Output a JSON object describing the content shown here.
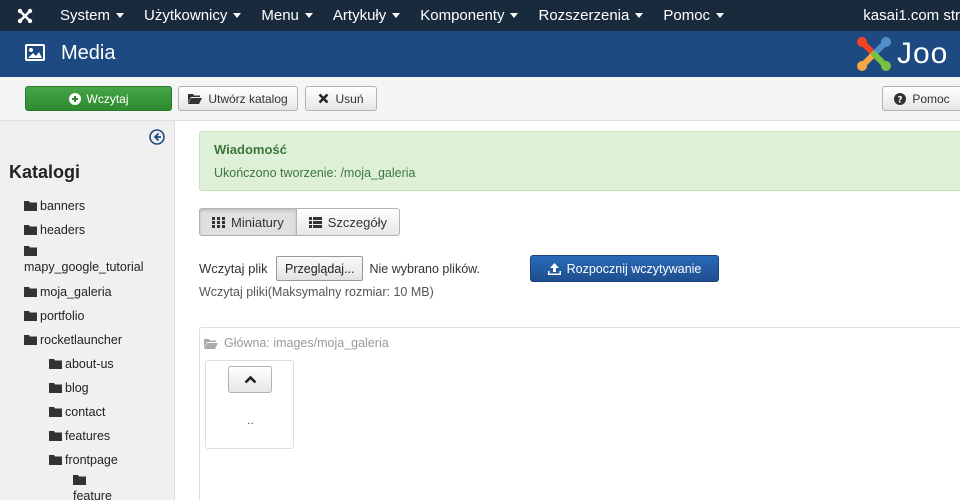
{
  "navbar": {
    "logo_icon": "joomla-icon",
    "items": [
      {
        "label": "System"
      },
      {
        "label": "Użytkownicy"
      },
      {
        "label": "Menu"
      },
      {
        "label": "Artykuły"
      },
      {
        "label": "Komponenty"
      },
      {
        "label": "Rozszerzenia"
      },
      {
        "label": "Pomoc"
      }
    ],
    "site_name": "kasai1.com str"
  },
  "header": {
    "icon": "image-icon",
    "title": "Media",
    "brand": "Joo"
  },
  "toolbar": {
    "upload_label": "Wczytaj",
    "create_folder_label": "Utwórz katalog",
    "delete_label": "Usuń",
    "help_label": "Pomoc"
  },
  "sidebar": {
    "title": "Katalogi",
    "folders": [
      {
        "label": "banners",
        "level": 0
      },
      {
        "label": "headers",
        "level": 0
      },
      {
        "label": "mapy_google_tutorial",
        "level": 0
      },
      {
        "label": "moja_galeria",
        "level": 0
      },
      {
        "label": "portfolio",
        "level": 0
      },
      {
        "label": "rocketlauncher",
        "level": 0
      },
      {
        "label": "about-us",
        "level": 1
      },
      {
        "label": "blog",
        "level": 1
      },
      {
        "label": "contact",
        "level": 1
      },
      {
        "label": "features",
        "level": 1
      },
      {
        "label": "frontpage",
        "level": 1
      },
      {
        "label": "feature",
        "level": 2
      }
    ]
  },
  "alert": {
    "heading": "Wiadomość",
    "message": "Ukończono tworzenie: /moja_galeria",
    "color": "#dff0d8"
  },
  "view": {
    "thumbnails_label": "Miniatury",
    "details_label": "Szczegóły",
    "active": "thumbnails"
  },
  "upload": {
    "label": "Wczytaj plik",
    "browse_label": "Przeglądaj...",
    "no_file": "Nie wybrano plików.",
    "start_label": "Rozpocznij wczytywanie",
    "hint": "Wczytaj pliki(Maksymalny rozmiar: 10 MB)"
  },
  "browser": {
    "path": "Główna: images/moja_galeria",
    "up_label": ".."
  }
}
